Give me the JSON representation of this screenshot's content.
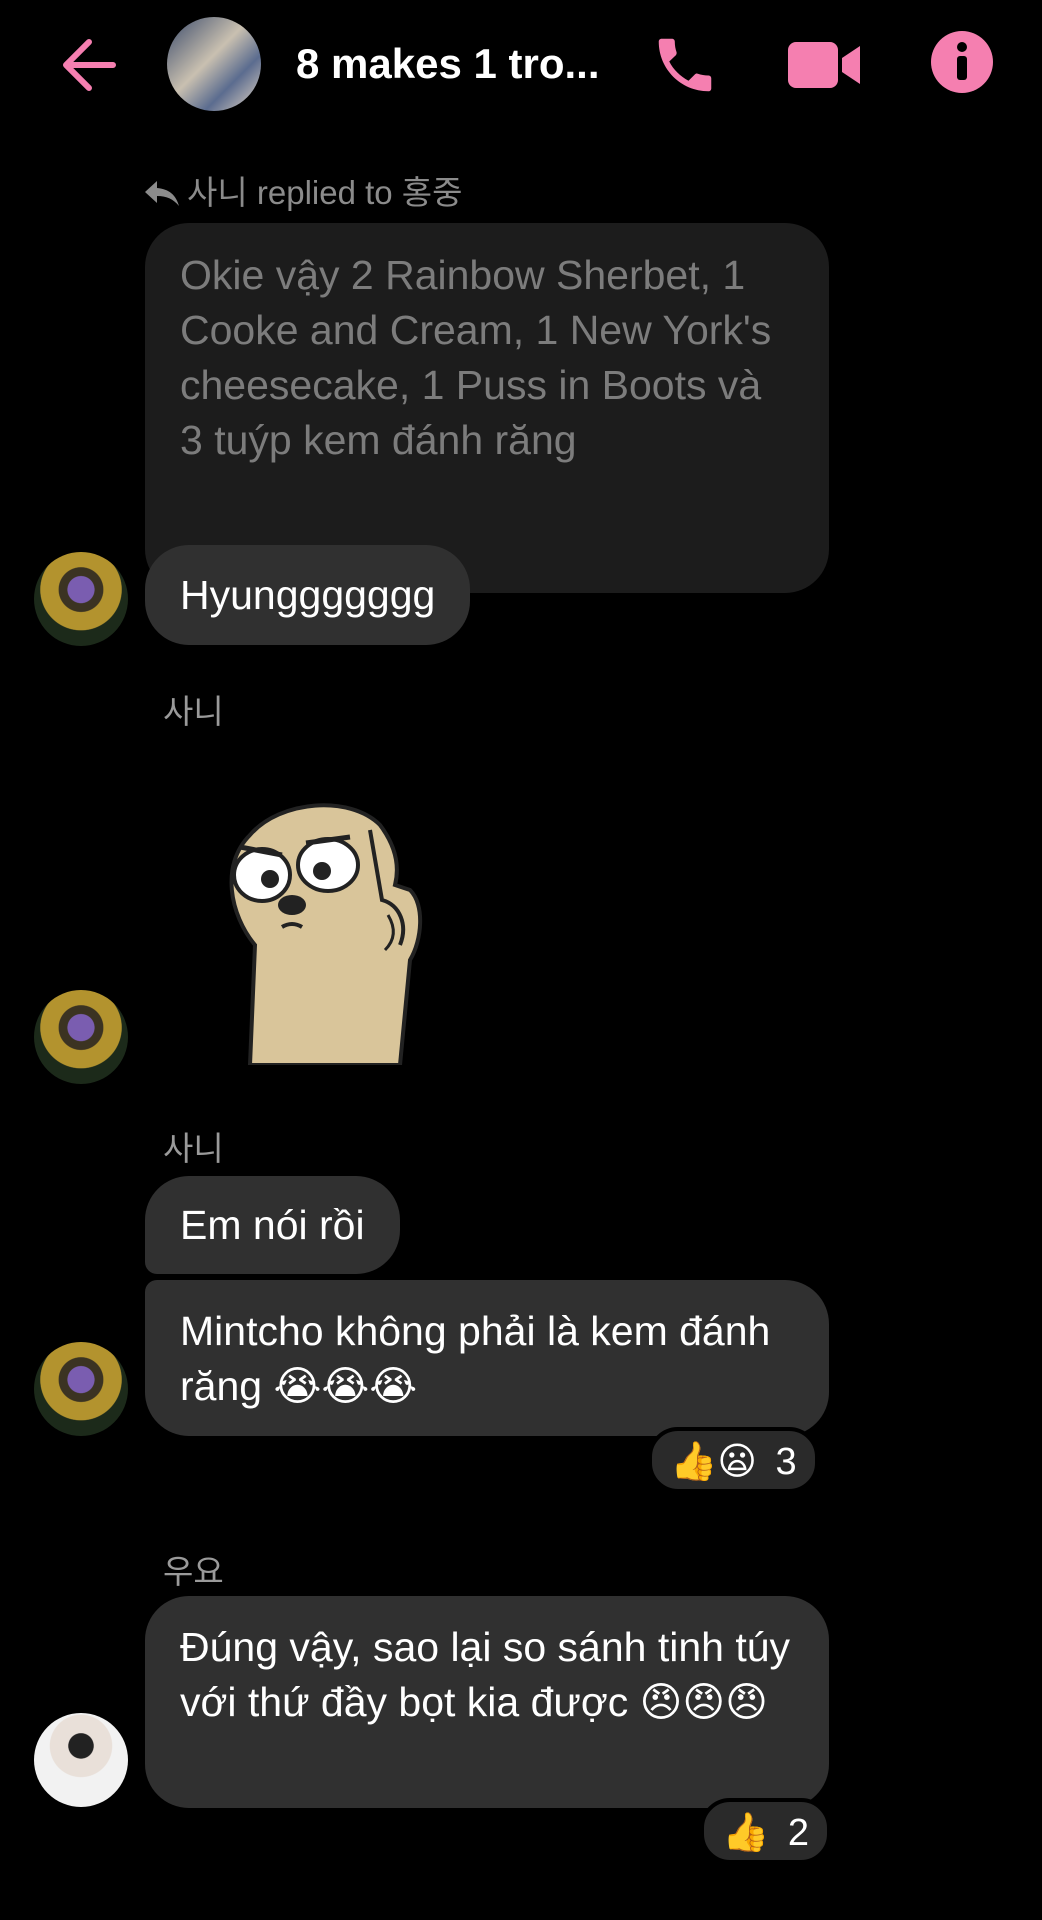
{
  "header": {
    "title": "8 makes 1 tro...",
    "accent_color": "#f57fb0",
    "icons": [
      "back-arrow-icon",
      "phone-icon",
      "video-camera-icon",
      "info-icon"
    ]
  },
  "thread": {
    "reply_meta": "사니 replied to 홍중",
    "quoted_text": "Okie vậy 2 Rainbow Sherbet, 1 Cooke and Cream, 1 New York's cheesecake, 1 Puss in Boots và 3 tuýp kem đánh răng",
    "messages": [
      {
        "text": "Hyunggggggg"
      },
      {
        "sender": "사니",
        "sticker": "sloth-pointing-finger-sticker"
      },
      {
        "sender": "사니",
        "text": "Em nói rồi"
      },
      {
        "text": "Mintcho không phải là kem đánh răng 😭😭😭",
        "reactions": "👍😦",
        "reaction_count": "3"
      },
      {
        "sender": "우요",
        "text": "Đúng vậy, sao lại so sánh tinh túy với thứ đầy bọt kia được 😠😠😠",
        "reactions": "👍",
        "reaction_count": "2"
      }
    ]
  }
}
